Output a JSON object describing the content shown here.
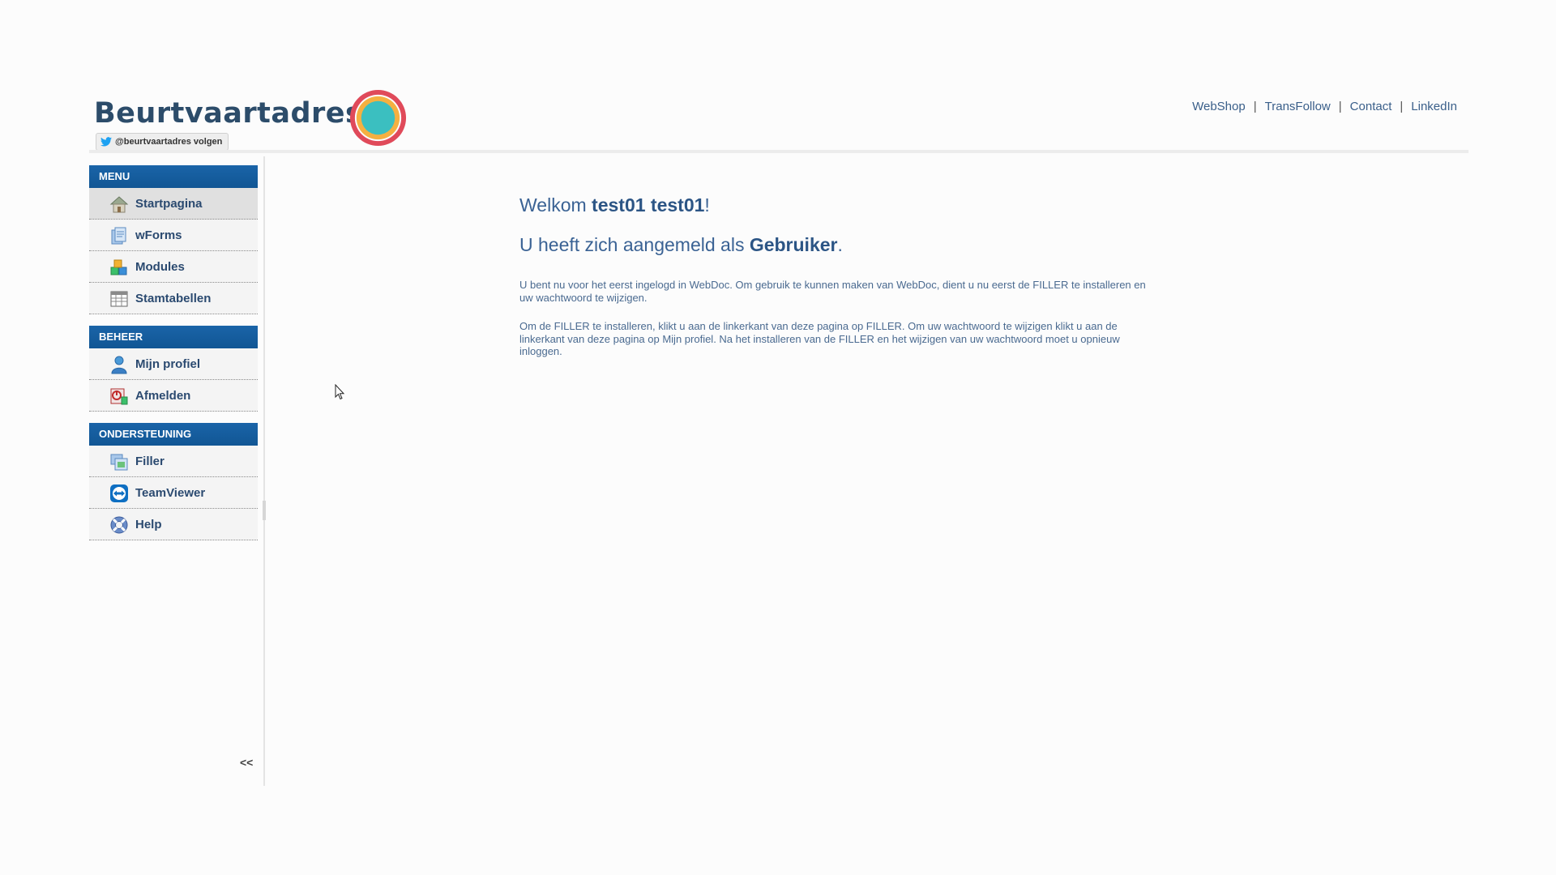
{
  "header": {
    "logo_text": "Beurtvaartadres",
    "twitter_label": "@beurtvaartadres volgen",
    "links": [
      "WebShop",
      "TransFollow",
      "Contact",
      "LinkedIn"
    ]
  },
  "sidebar": {
    "sections": [
      {
        "title": "MENU",
        "items": [
          {
            "label": "Startpagina"
          },
          {
            "label": "wForms"
          },
          {
            "label": "Modules"
          },
          {
            "label": "Stamtabellen"
          }
        ]
      },
      {
        "title": "BEHEER",
        "items": [
          {
            "label": "Mijn profiel"
          },
          {
            "label": "Afmelden"
          }
        ]
      },
      {
        "title": "ONDERSTEUNING",
        "items": [
          {
            "label": "Filler"
          },
          {
            "label": "TeamViewer"
          },
          {
            "label": "Help"
          }
        ]
      }
    ],
    "collapse_label": "<<"
  },
  "main": {
    "welcome_prefix": "Welkom ",
    "welcome_name": "test01 test01",
    "welcome_suffix": "!",
    "role_prefix": "U heeft zich aangemeld als ",
    "role_name": "Gebruiker",
    "role_suffix": ".",
    "paragraph1": "U bent nu voor het eerst ingelogd in WebDoc. Om gebruik te kunnen maken van WebDoc, dient u nu eerst de FILLER te installeren en uw wachtwoord te wijzigen.",
    "paragraph2": "Om de FILLER te installeren, klikt u aan de linkerkant van deze pagina op FILLER. Om uw wachtwoord te wijzigen klikt u aan de linkerkant van deze pagina op Mijn profiel. Na het installeren van de FILLER en het wijzigen van uw wachtwoord moet u opnieuw inloggen."
  },
  "colors": {
    "menu_header": "#115694",
    "ring_outer": "#e04a5a",
    "ring_middle": "#f5b041",
    "ring_inner": "#3bbfc0"
  }
}
